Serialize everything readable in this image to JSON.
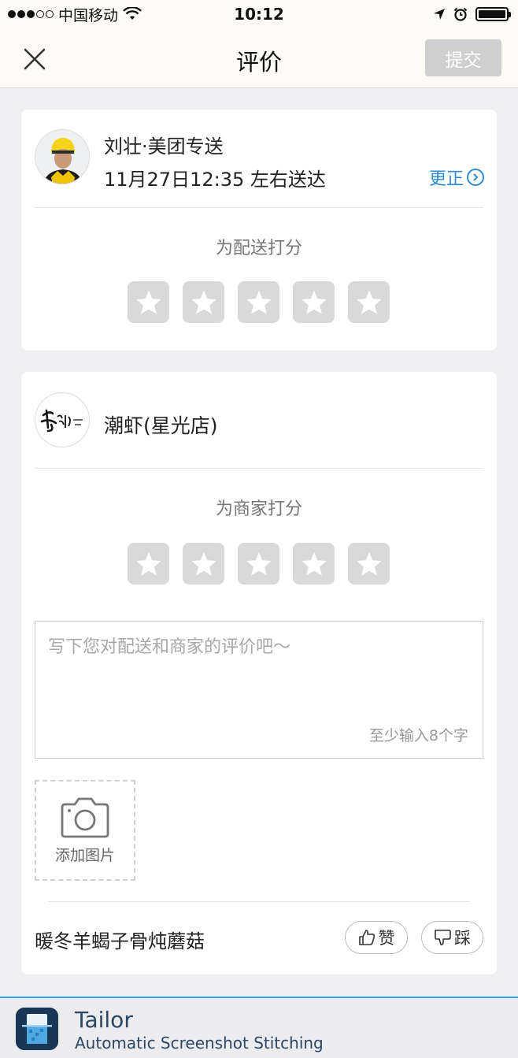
{
  "status_bar": {
    "carrier": "中国移动",
    "time": "10:12",
    "signal_bars_filled": 3,
    "signal_bars_total": 5,
    "battery_level": 1.0
  },
  "nav": {
    "title": "评价",
    "submit_label": "提交"
  },
  "courier": {
    "name": "刘壮·美团专送",
    "delivery_time": "11月27日12:35 左右送达",
    "correct_label": "更正",
    "rate_label": "为配送打分",
    "star_count": 5
  },
  "shop": {
    "name": "潮虾(星光店)",
    "rate_label": "为商家打分",
    "star_count": 5,
    "review_placeholder": "写下您对配送和商家的评价吧～",
    "min_hint": "至少输入8个字",
    "add_photo_label": "添加图片",
    "dish_name": "暖冬羊蝎子骨炖蘑菇",
    "like_label": "赞",
    "dislike_label": "踩"
  },
  "banner": {
    "title": "Tailor",
    "subtitle": "Automatic Screenshot Stitching"
  },
  "colors": {
    "accent_blue": "#2f8bd6",
    "star_bg": "#d9d9d9",
    "submit_disabled": "#cfcfcf",
    "banner_border": "#2ea6e8"
  }
}
